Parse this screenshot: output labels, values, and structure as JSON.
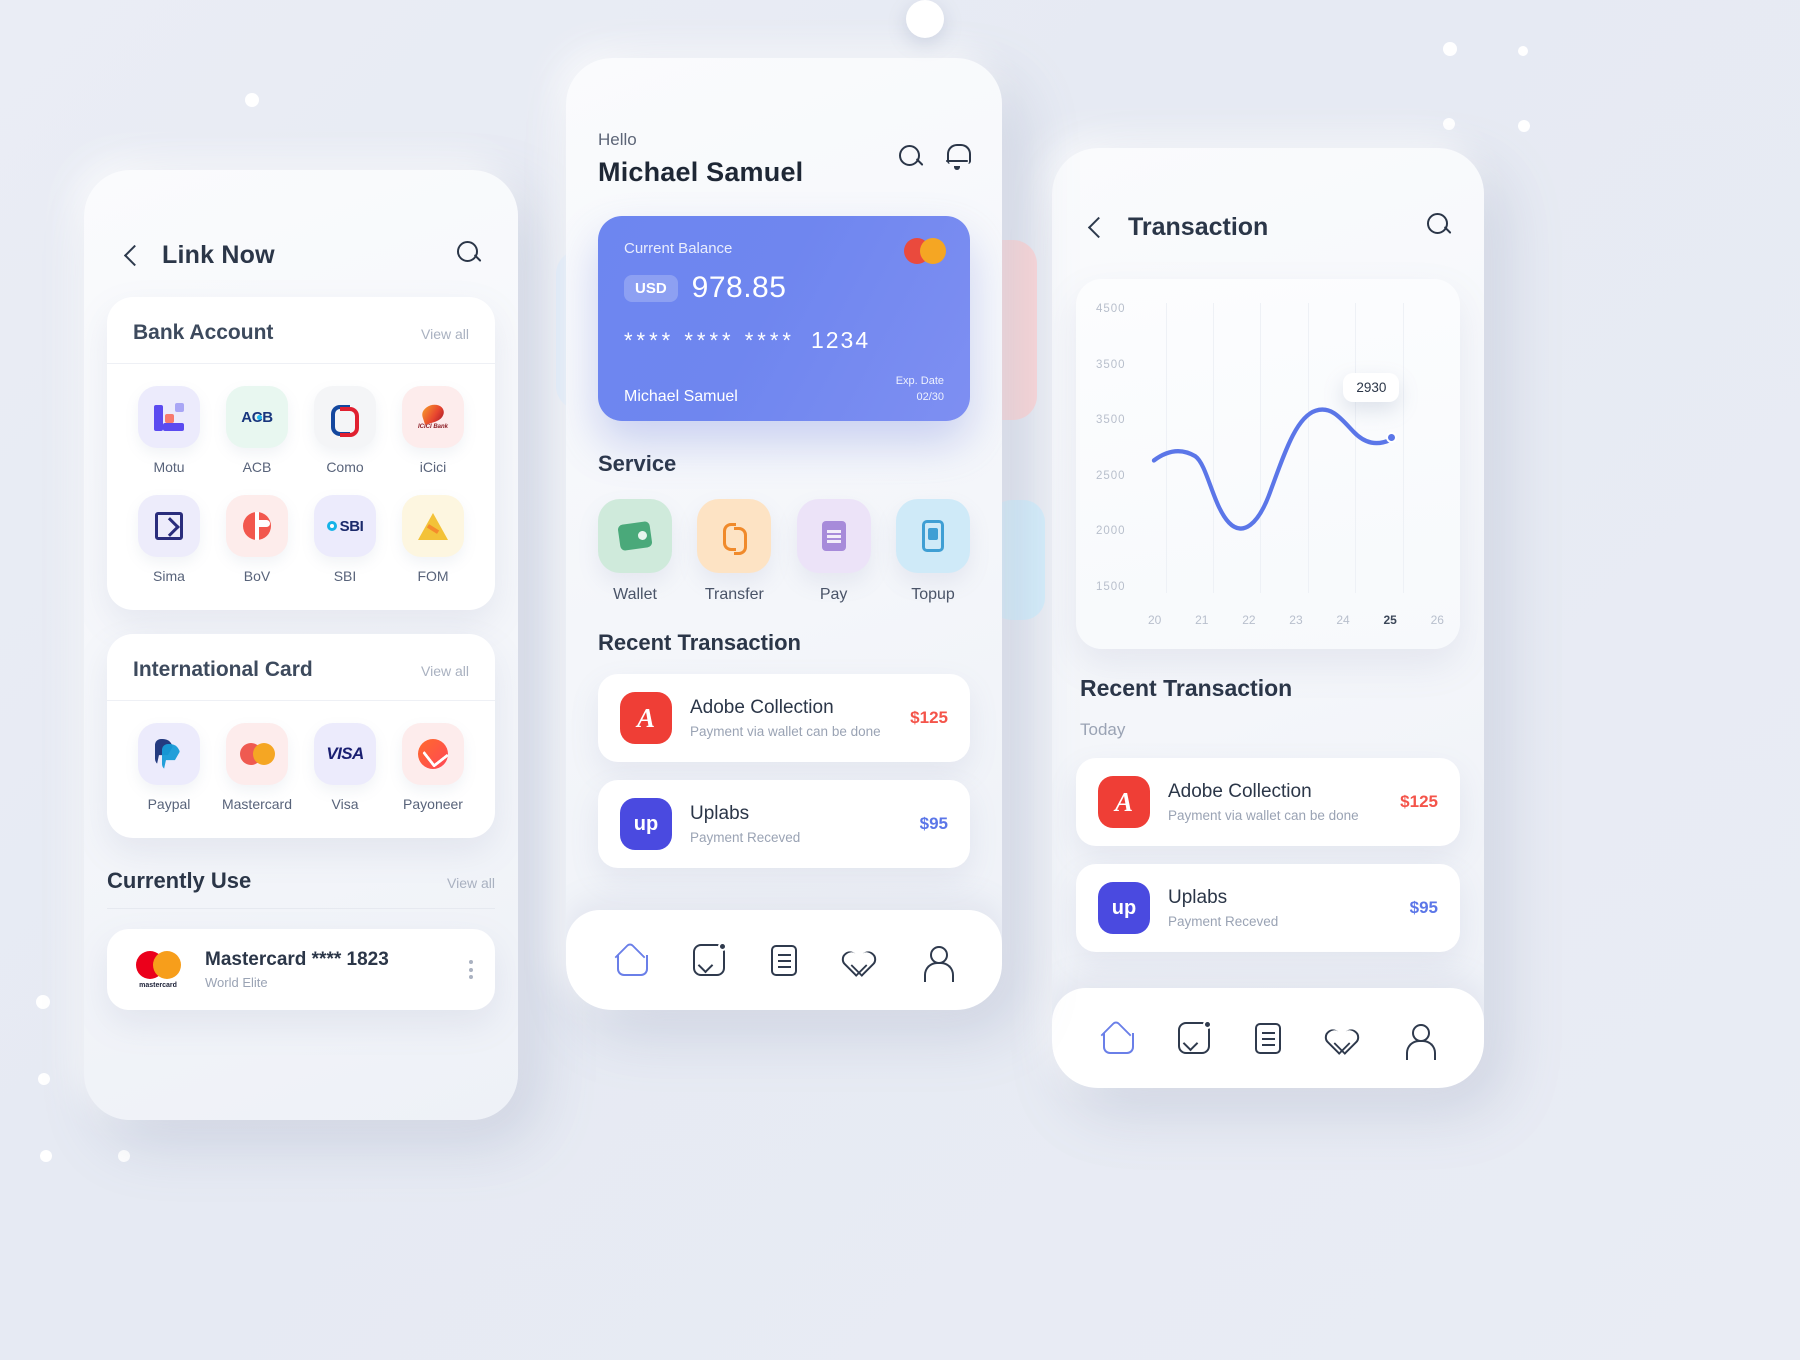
{
  "background": {
    "color": "#eaedf5"
  },
  "link_now": {
    "title": "Link Now",
    "back_icon": "chevron-left-icon",
    "search_icon": "search-icon",
    "bank_account": {
      "title": "Bank Account",
      "view_all": "View all",
      "items": [
        {
          "label": "Motu",
          "tile_bg": "#ecebfc",
          "mark": "motu"
        },
        {
          "label": "ACB",
          "tile_bg": "#e8f7f0",
          "mark": "acb"
        },
        {
          "label": "Como",
          "tile_bg": "#f4f5f7",
          "mark": "como"
        },
        {
          "label": "iCici",
          "tile_bg": "#fdecec",
          "mark": "icici"
        },
        {
          "label": "Sima",
          "tile_bg": "#edecfb",
          "mark": "sima"
        },
        {
          "label": "BoV",
          "tile_bg": "#fdeceb",
          "mark": "bov"
        },
        {
          "label": "SBI",
          "tile_bg": "#ecebfc",
          "mark": "sbi"
        },
        {
          "label": "FOM",
          "tile_bg": "#fdf6e0",
          "mark": "fom"
        }
      ]
    },
    "international_card": {
      "title": "International Card",
      "view_all": "View all",
      "items": [
        {
          "label": "Paypal",
          "tile_bg": "#ecebfc",
          "mark": "paypal"
        },
        {
          "label": "Mastercard",
          "tile_bg": "#fdecec",
          "mark": "mastercard"
        },
        {
          "label": "Visa",
          "tile_bg": "#ecebfc",
          "mark": "visa"
        },
        {
          "label": "Payoneer",
          "tile_bg": "#fdecec",
          "mark": "payoneer"
        }
      ]
    },
    "currently_use": {
      "title": "Currently Use",
      "view_all": "View all",
      "card": {
        "brand_text": "mastercard",
        "name": "Mastercard **** 1823",
        "sub": "World Elite",
        "menu_icon": "kebab-menu-icon"
      }
    }
  },
  "home": {
    "greeting": "Hello",
    "user_name": "Michael Samuel",
    "search_icon": "search-icon",
    "bell_icon": "notification-bell-icon",
    "balance_card": {
      "label": "Current Balance",
      "currency": "USD",
      "amount": "978.85",
      "masked_number": "****  ****  ****",
      "last4": "1234",
      "holder": "Michael Samuel",
      "exp_label": "Exp. Date",
      "exp_value": "02/30",
      "accent": "#6d86f0"
    },
    "service": {
      "title": "Service",
      "items": [
        {
          "label": "Wallet",
          "tile_bg": "#cfeadb",
          "icon": "wallet-icon"
        },
        {
          "label": "Transfer",
          "tile_bg": "#fde3c4",
          "icon": "transfer-icon"
        },
        {
          "label": "Pay",
          "tile_bg": "#ece3f8",
          "icon": "document-pay-icon"
        },
        {
          "label": "Topup",
          "tile_bg": "#cfeaf8",
          "icon": "mobile-topup-icon"
        }
      ]
    },
    "recent": {
      "title": "Recent Transaction",
      "items": [
        {
          "logo": "adobe-icon",
          "logo_text": "A",
          "title": "Adobe Collection",
          "sub": "Payment via wallet can be done",
          "amount": "$125",
          "amount_color": "#f4544a"
        },
        {
          "logo": "uplabs-icon",
          "logo_text": "up",
          "title": "Uplabs",
          "sub": "Payment Receved",
          "amount": "$95",
          "amount_color": "#5b76e8"
        }
      ]
    },
    "nav": [
      {
        "name": "home",
        "active": true
      },
      {
        "name": "analytics",
        "active": false
      },
      {
        "name": "document",
        "active": false
      },
      {
        "name": "favorites",
        "active": false
      },
      {
        "name": "profile",
        "active": false
      }
    ]
  },
  "transaction": {
    "title": "Transaction",
    "back_icon": "chevron-left-icon",
    "search_icon": "search-icon",
    "recent_title": "Recent Transaction",
    "today_label": "Today",
    "items": [
      {
        "logo": "adobe-icon",
        "logo_text": "A",
        "title": "Adobe Collection",
        "sub": "Payment via wallet can be done",
        "amount": "$125",
        "amount_color": "#f4544a"
      },
      {
        "logo": "uplabs-icon",
        "logo_text": "up",
        "title": "Uplabs",
        "sub": "Payment Receved",
        "amount": "$95",
        "amount_color": "#5b76e8"
      }
    ],
    "nav": [
      {
        "name": "home",
        "active": true
      },
      {
        "name": "analytics",
        "active": false
      },
      {
        "name": "document",
        "active": false
      },
      {
        "name": "favorites",
        "active": false
      },
      {
        "name": "profile",
        "active": false
      }
    ]
  },
  "chart_data": {
    "type": "line",
    "title": "",
    "xlabel": "",
    "ylabel": "",
    "line_color": "#5b76e8",
    "grid": true,
    "legend": "none",
    "y_ticks": [
      "4500",
      "3500",
      "3500",
      "2500",
      "2000",
      "1500"
    ],
    "ylim": [
      1500,
      4500
    ],
    "categories": [
      "20",
      "21",
      "22",
      "23",
      "24",
      "25",
      "26"
    ],
    "highlight_category": "25",
    "annotation": {
      "label": "2930",
      "at_x": "25",
      "at_y": 2930
    },
    "x": [
      20,
      20.5,
      21,
      21.5,
      22,
      22.5,
      23,
      23.5,
      24,
      24.5,
      25
    ],
    "values": [
      2640,
      2700,
      2690,
      2400,
      1980,
      2050,
      2600,
      3150,
      3280,
      3010,
      2930
    ]
  }
}
